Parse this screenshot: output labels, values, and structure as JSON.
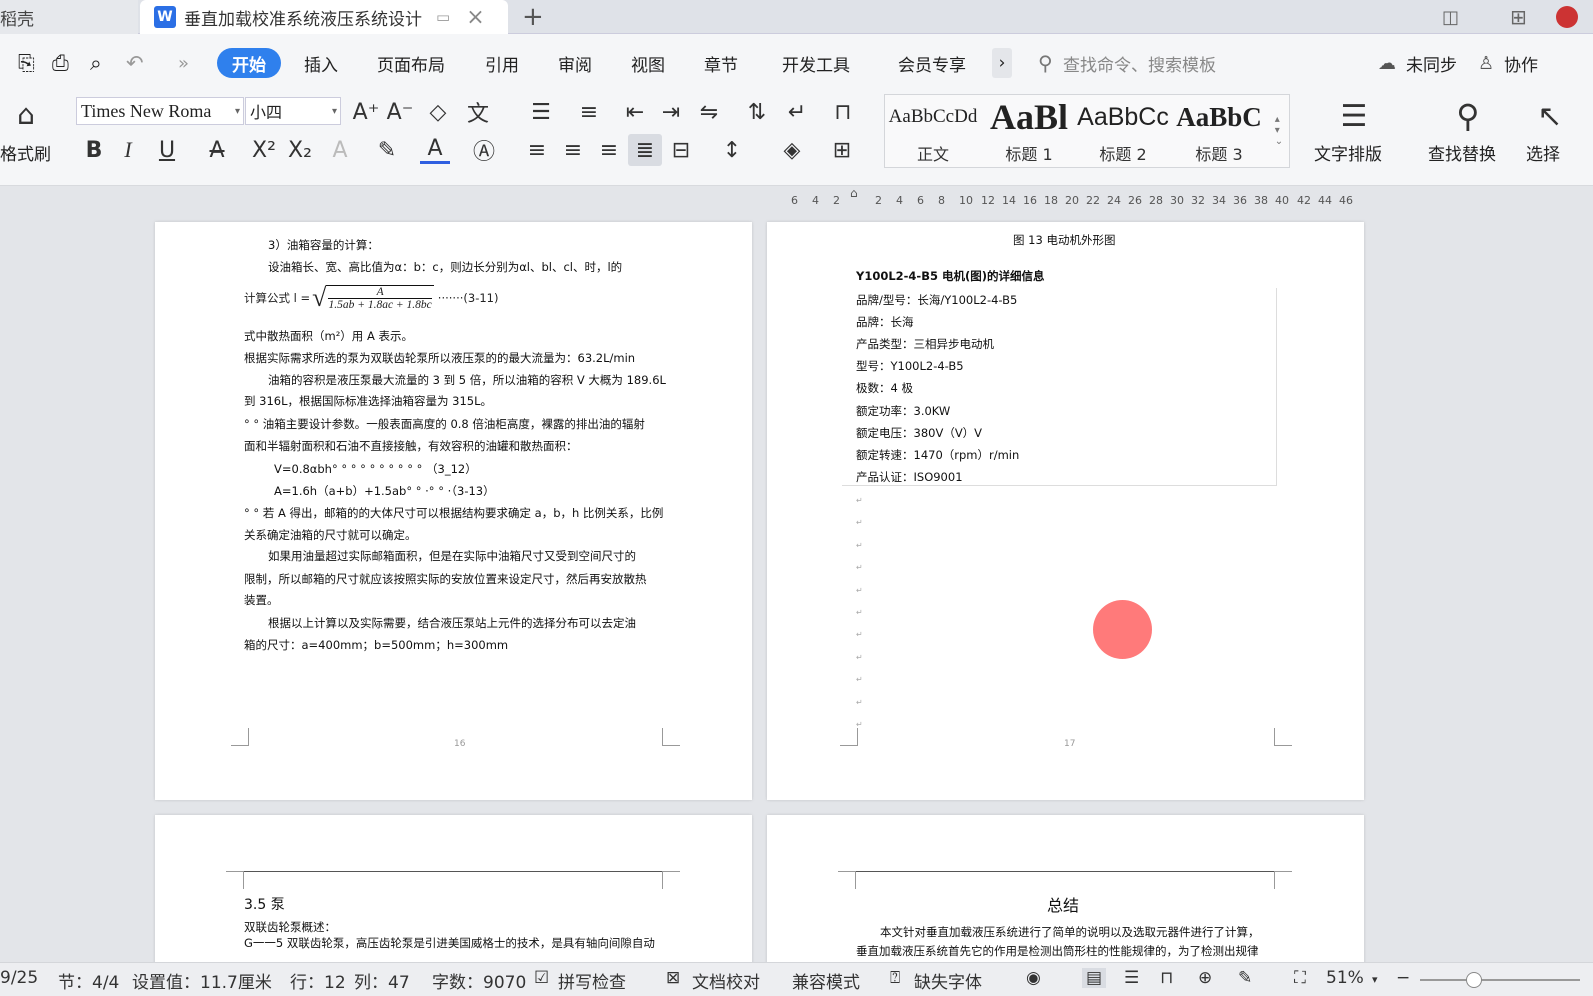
{
  "tabs": {
    "shell_label": "稻壳",
    "doc_title": "垂直加载校准系统液压系统设计",
    "new_tab": "+",
    "doc_icon": "W"
  },
  "menu": {
    "items": [
      "开始",
      "插入",
      "页面布局",
      "引用",
      "审阅",
      "视图",
      "章节",
      "开发工具",
      "会员专享"
    ],
    "more": "›",
    "search_placeholder": "查找命令、搜索模板",
    "sync": "未同步",
    "collab": "协作"
  },
  "ribbon": {
    "format_painter": "格式刷",
    "font_name": "Times New Roma",
    "font_size": "小四",
    "styles": [
      {
        "sample": "AaBbCcDd",
        "label": "正文"
      },
      {
        "sample": "AaBl",
        "label": "标题 1"
      },
      {
        "sample": "AaBbCc",
        "label": "标题 2"
      },
      {
        "sample": "AaBbC",
        "label": "标题 3"
      }
    ],
    "text_layout": "文字排版",
    "find_replace": "查找替换",
    "select": "选择"
  },
  "ruler": {
    "ticks": [
      "6",
      "4",
      "2",
      "2",
      "4",
      "6",
      "8",
      "10",
      "12",
      "14",
      "16",
      "18",
      "20",
      "22",
      "24",
      "26",
      "28",
      "30",
      "32",
      "34",
      "36",
      "38",
      "40",
      "42",
      "44",
      "46"
    ]
  },
  "page16": {
    "lines": [
      "3）油箱容量的计算：",
      "设油箱长、宽、高比值为α：b：c，则边长分别为αl、bl、cl、时，l的",
      "式中散热面积（m²）用 A 表示。",
      "根据实际需求所选的泵为双联齿轮泵所以液压泵的的最大流量为：63.2L/min",
      "油箱的容积是液压泵最大流量的 3 到 5 倍，所以油箱的容积 V 大概为 189.6L",
      "到 316L，根据国际标准选择油箱容量为 315L。",
      "° ° 油箱主要设计参数。一般表面高度的 0.8 倍油柜高度，裸露的排出油的辐射",
      "面和半辐射面积和石油不直接接触，有效容积的油罐和散热面积：",
      "V=0.8αbh° ° ° ° ° ° ° ° ° ° （3_12）",
      "A=1.6h（a+b）+1.5ab° ° ·° ° ·（3-13）",
      "° ° 若 A 得出，邮箱的的大体尺寸可以根据结构要求确定 a，b，h 比例关系，比例",
      "关系确定油箱的尺寸就可以确定。",
      "如果用油量超过实际邮箱面积，但是在实际中油箱尺寸又受到空间尺寸的",
      "限制，所以邮箱的尺寸就应该按照实际的安放位置来设定尺寸，然后再安放散热",
      "装置。",
      "根据以上计算以及实际需要，结合液压泵站上元件的选择分布可以去定油",
      "箱的尺寸：a=400mm；b=500mm；h=300mm"
    ],
    "formula_label": "计算公式 l =",
    "formula_num": "A",
    "formula_den": "1.5ab + 1.8ac + 1.8bc",
    "formula_tail": "·······(3-11)",
    "page_number": "16"
  },
  "page17": {
    "caption": "图 13 电动机外形图",
    "heading": "Y100L2-4-B5 电机(图)的详细信息",
    "specs": [
      "品牌/型号：长海/Y100L2-4-B5",
      "品牌：长海",
      "产品类型：三相异步电动机",
      "型号：Y100L2-4-B5",
      "极数：4 极",
      "额定功率：3.0KW",
      "额定电压：380V（V）V",
      "额定转速：1470（rpm）r/min",
      "产品认证：ISO9001"
    ],
    "page_number": "17"
  },
  "page18": {
    "heading": "3.5 泵",
    "lines": [
      "双联齿轮泵概述：",
      "G一一5 双联齿轮泵，高压齿轮泵是引进美国威格士的技术，是具有轴向间隙自动"
    ]
  },
  "page19": {
    "heading": "总结",
    "lines": [
      "本文针对垂直加载液压系统进行了简单的说明以及选取元器件进行了计算，",
      "垂直加载液压系统首先它的作用是检测出筒形柱的性能规律的，为了检测出规律"
    ]
  },
  "status": {
    "page": "9/25",
    "section": "节：4/4",
    "setting": "设置值：11.7厘米",
    "row": "行：12",
    "col": "列：47",
    "wordcount": "字数：9070",
    "spellcheck": "拼写检查",
    "doccheck": "文档校对",
    "compat": "兼容模式",
    "missing_font": "缺失字体",
    "zoom": "51%"
  },
  "colors": {
    "accent": "#2f80ed",
    "cursor_dot": "#ff7a7a"
  }
}
